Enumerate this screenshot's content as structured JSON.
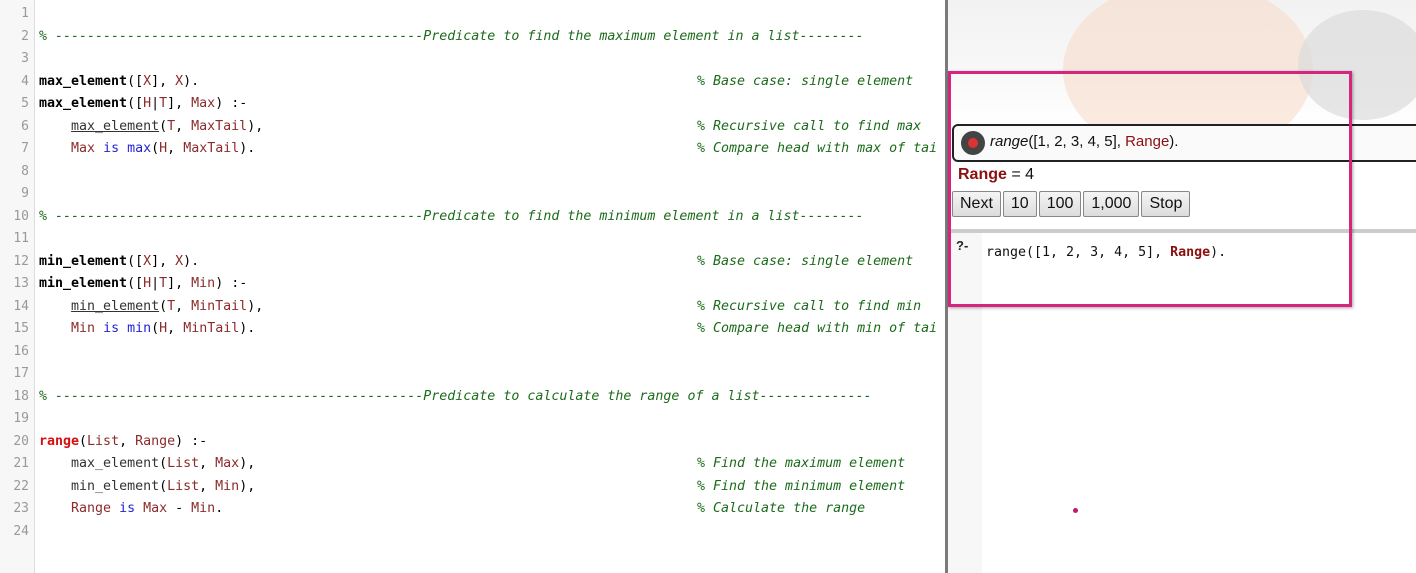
{
  "editor": {
    "lines": [
      {
        "n": "1",
        "code": "",
        "comment": ""
      },
      {
        "n": "2",
        "code": "% ----------------------------------------------Predicate to find the maximum element in a list--------",
        "comment": ""
      },
      {
        "n": "3",
        "code": "",
        "comment": ""
      },
      {
        "n": "4",
        "code": "max_element([X], X).",
        "comment": "% Base case: single element"
      },
      {
        "n": "5",
        "code": "max_element([H|T], Max) :-",
        "comment": ""
      },
      {
        "n": "6",
        "code": "    max_element(T, MaxTail),",
        "comment": "% Recursive call to find max"
      },
      {
        "n": "7",
        "code": "    Max is max(H, MaxTail).",
        "comment": "% Compare head with max of tai"
      },
      {
        "n": "8",
        "code": "",
        "comment": ""
      },
      {
        "n": "9",
        "code": "",
        "comment": ""
      },
      {
        "n": "10",
        "code": "% ----------------------------------------------Predicate to find the minimum element in a list--------",
        "comment": ""
      },
      {
        "n": "11",
        "code": "",
        "comment": ""
      },
      {
        "n": "12",
        "code": "min_element([X], X).",
        "comment": "% Base case: single element"
      },
      {
        "n": "13",
        "code": "min_element([H|T], Min) :-",
        "comment": ""
      },
      {
        "n": "14",
        "code": "    min_element(T, MinTail),",
        "comment": "% Recursive call to find min"
      },
      {
        "n": "15",
        "code": "    Min is min(H, MinTail).",
        "comment": "% Compare head with min of tai"
      },
      {
        "n": "16",
        "code": "",
        "comment": ""
      },
      {
        "n": "17",
        "code": "",
        "comment": ""
      },
      {
        "n": "18",
        "code": "% ----------------------------------------------Predicate to calculate the range of a list--------------",
        "comment": ""
      },
      {
        "n": "19",
        "code": "",
        "comment": ""
      },
      {
        "n": "20",
        "code": "range(List, Range) :-",
        "comment": ""
      },
      {
        "n": "21",
        "code": "    max_element(List, Max),",
        "comment": "% Find the maximum element"
      },
      {
        "n": "22",
        "code": "    min_element(List, Min),",
        "comment": "% Find the minimum element"
      },
      {
        "n": "23",
        "code": "    Range is Max - Min.",
        "comment": "% Calculate the range"
      },
      {
        "n": "24",
        "code": "",
        "comment": ""
      }
    ]
  },
  "query": {
    "predicate": "range",
    "args_open": "([1, 2, 3, 4, 5], ",
    "var": "Range",
    "args_close": ")."
  },
  "answer": {
    "var": "Range",
    "rest": " = 4"
  },
  "buttons": {
    "next": "Next",
    "ten": "10",
    "hundred": "100",
    "thousand": "1,000",
    "stop": "Stop"
  },
  "prompt": {
    "label": "?-",
    "input_prefix": "range([1, 2, 3, 4, 5], ",
    "input_var": "Range",
    "input_suffix": ")."
  },
  "colors": {
    "highlight": "#d4267e",
    "comment": "#1c6b1c",
    "variable": "#8b1010"
  }
}
